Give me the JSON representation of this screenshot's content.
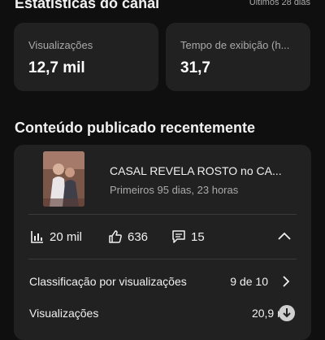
{
  "header": {
    "title": "Estatísticas do canal",
    "period": "Últimos 28 dias"
  },
  "stats": [
    {
      "label": "Visualizações",
      "value": "12,7 mil"
    },
    {
      "label": "Tempo de exibição (h...",
      "value": "31,7"
    }
  ],
  "recent": {
    "section_title": "Conteúdo publicado recentemente",
    "video": {
      "title": "CASAL REVELA ROSTO no CA...",
      "subtitle": "Primeiros 95 dias, 23 horas"
    },
    "metrics": {
      "views": "20 mil",
      "likes": "636",
      "comments": "15"
    },
    "ranking": {
      "label": "Classificação por visualizações",
      "value": "9 de 10"
    },
    "views_row": {
      "label": "Visualizações",
      "value": "20,9 mil"
    }
  },
  "colors": {
    "background": "#0f0f0f",
    "card": "#212121",
    "muted_text": "#aaaaaa"
  }
}
